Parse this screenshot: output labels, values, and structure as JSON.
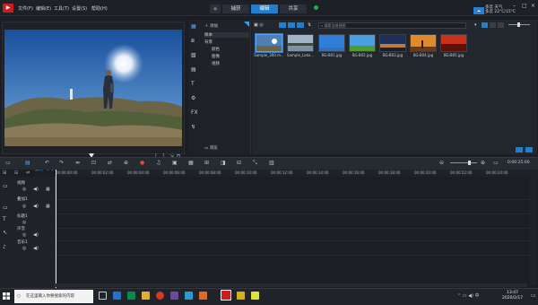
{
  "menu": [
    "文件(F)",
    "编辑(E)",
    "工具(T)",
    "设置(S)",
    "帮助(H)"
  ],
  "tabs": {
    "capture": "捕获",
    "edit": "编辑",
    "share": "共享"
  },
  "weather": {
    "line1": "多云 天气",
    "line2": "多云 22°C/15°C"
  },
  "player": {
    "project_label": "项目",
    "clip_label": "素材",
    "timecode": "00:00:00:00"
  },
  "library": {
    "add_label": "添加",
    "folders": [
      "样本",
      "背景",
      "颜色",
      "图像",
      "视频"
    ],
    "browse_label": "浏览",
    "search_placeholder": "搜索当前视图",
    "thumbs": [
      {
        "label": "Sample_360.m...",
        "kind": "panorama"
      },
      {
        "label": "Sample_Lake...",
        "kind": "lake"
      },
      {
        "label": "BG-B01.jpg",
        "kind": "sky"
      },
      {
        "label": "BG-B02.jpg",
        "kind": "field"
      },
      {
        "label": "BG-B03.jpg",
        "kind": "dusk"
      },
      {
        "label": "BG-B04.jpg",
        "kind": "sunset"
      },
      {
        "label": "BG-B05.jpg",
        "kind": "red"
      }
    ]
  },
  "timeline": {
    "zoom_readout": "0:00:25:00",
    "ruler": [
      "00:00:00:00",
      "00:00:02:00",
      "00:00:04:00",
      "00:00:06:00",
      "00:00:08:00",
      "00:00:10:00",
      "00:00:12:00",
      "00:00:14:00",
      "00:00:16:00",
      "00:00:18:00",
      "00:00:20:00",
      "00:00:22:00",
      "00:00:24:00"
    ],
    "tracks": [
      "视频",
      "叠加1",
      "标题1",
      "声音",
      "音乐1"
    ]
  },
  "taskbar": {
    "search_placeholder": "在这里输入你要搜索的内容",
    "time": "13:47",
    "date": "2020/2/17"
  },
  "colors": {
    "accent": "#1f7fd0",
    "bg": "#1b1e24"
  }
}
